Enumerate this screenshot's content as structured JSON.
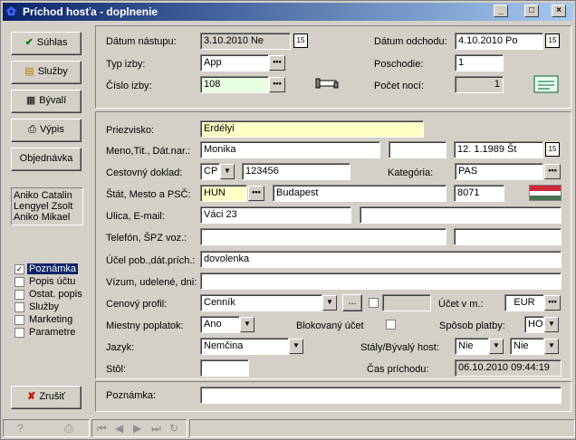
{
  "window": {
    "title": "Príchod hosťa - doplnenie"
  },
  "buttons": {
    "suhlas": "Súhlas",
    "sluzby": "Služby",
    "byvali": "Bývalí",
    "vypis": "Výpis",
    "objednavka": "Objednávka",
    "zrusit": "Zrušiť"
  },
  "guests": [
    "Aniko Catalin",
    "Lengyel Zsolt",
    "Aniko Mikael"
  ],
  "options": [
    {
      "label": "Poznámka",
      "checked": true
    },
    {
      "label": "Popis účtu",
      "checked": false
    },
    {
      "label": "Ostat. popis",
      "checked": false
    },
    {
      "label": "Služby",
      "checked": false
    },
    {
      "label": "Marketing",
      "checked": false
    },
    {
      "label": "Parametre",
      "checked": false
    }
  ],
  "labels": {
    "datum_nastupu": "Dátum nástupu:",
    "typ_izby": "Typ izby:",
    "cislo_izby": "Číslo izby:",
    "datum_odchodu": "Dátum odchodu:",
    "poschodie": "Poschodie:",
    "pocet_noci": "Počet nocí:",
    "priezvisko": "Priezvisko:",
    "meno": "Meno,Tit., Dát.nar.:",
    "doklad": "Cestovný doklad:",
    "kategoria": "Kategória:",
    "stat": "Štát, Mesto a PSČ:",
    "ulica": "Ulica, E-mail:",
    "telefon": "Telefón, ŠPZ voz.:",
    "ucel": "Účel pob.,dát.prích.:",
    "vizum": "Vízum, udelené, dni:",
    "cenovy": "Cenový profil:",
    "ucet": "Účet v m.:",
    "poplatok": "Miestny poplatok:",
    "blokovany": "Blokovaný účet",
    "sposob": "Spôsob platby:",
    "jazyk": "Jazyk:",
    "stalyhost": "Stály/Bývalý host:",
    "stol": "Stôl:",
    "cas": "Čas príchodu:",
    "poznamka": "Poznámka:"
  },
  "values": {
    "datum_nastupu": "3.10.2010  Ne",
    "typ_izby": "App",
    "cislo_izby": "108",
    "datum_odchodu": "4.10.2010  Po",
    "poschodie": "1",
    "pocet_noci": "1",
    "priezvisko": "Erdélyi",
    "meno": "Monika",
    "titul": "",
    "datum_narodenia": "12. 1.1989  Št",
    "doklad_typ": "CP",
    "doklad_cislo": "123456",
    "kategoria": "PAS",
    "stat": "HUN",
    "mesto": "Budapest",
    "psc": "8071",
    "ulica": "Váci 23",
    "email": "",
    "telefon": "",
    "spz": "",
    "ucel": "dovolenka",
    "vizum": "",
    "cenovy": "Cenník",
    "cenovy_extra": "",
    "ucet": "EUR",
    "poplatok": "Ano",
    "sposob": "HO",
    "jazyk": "Nemčina",
    "staly": "Nie",
    "byvaly": "Nie",
    "stol": "",
    "cas": "06.10.2010 09:44:19",
    "poznamka": ""
  },
  "icons": {
    "dots": "•••",
    "dropdown": "▼",
    "calendar": "15",
    "ellipsis": "..."
  }
}
